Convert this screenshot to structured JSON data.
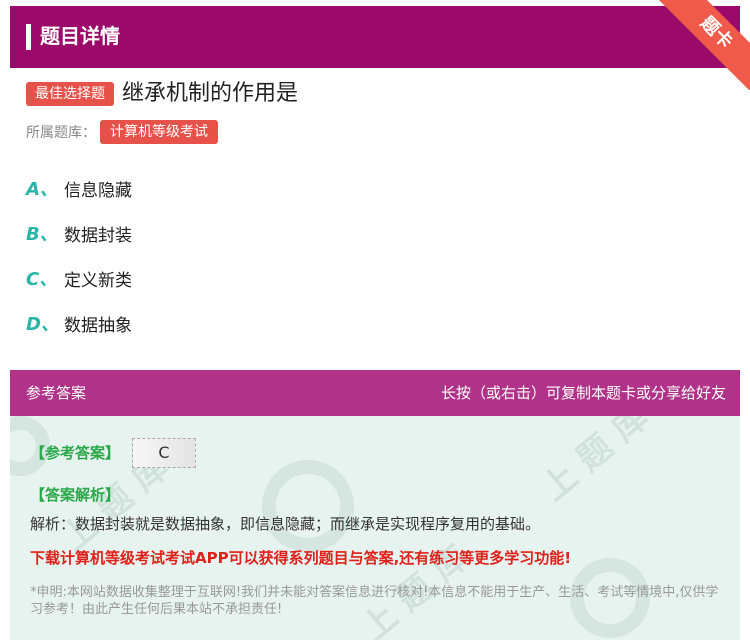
{
  "header": {
    "title": "题目详情"
  },
  "ribbon": {
    "label": "题卡"
  },
  "question": {
    "type_badge": "最佳选择题",
    "text": "继承机制的作用是",
    "category_label": "所属题库：",
    "category": "计算机等级考试"
  },
  "options": [
    {
      "letter": "A、",
      "text": "信息隐藏"
    },
    {
      "letter": "B、",
      "text": "数据封装"
    },
    {
      "letter": "C、",
      "text": "定义新类"
    },
    {
      "letter": "D、",
      "text": "数据抽象"
    }
  ],
  "answer_section": {
    "title": "参考答案",
    "tip": "长按（或右击）可复制本题卡或分享给好友",
    "ref_label": "【参考答案】",
    "ref_value": "C",
    "explain_label": "【答案解析】",
    "explain_text": "解析：数据封装就是数据抽象，即信息隐藏；而继承是实现程序复用的基础。",
    "promo": "下载计算机等级考试考试APP可以获得系列题目与答案,还有练习等更多学习功能!",
    "disclaimer": "*申明:本网站数据收集整理于互联网!我们并未能对答案信息进行核对!本信息不能用于生产、生活、考试等情境中,仅供学习参考！由此产生任何后果本站不承担责任!"
  },
  "colors": {
    "header_bg": "#9b0a6b",
    "answer_bar_bg": "#b03389",
    "badge_bg": "#e6524a",
    "option_letter": "#2bb5a8",
    "answer_label": "#2aa84a",
    "promo": "#e0201a"
  }
}
